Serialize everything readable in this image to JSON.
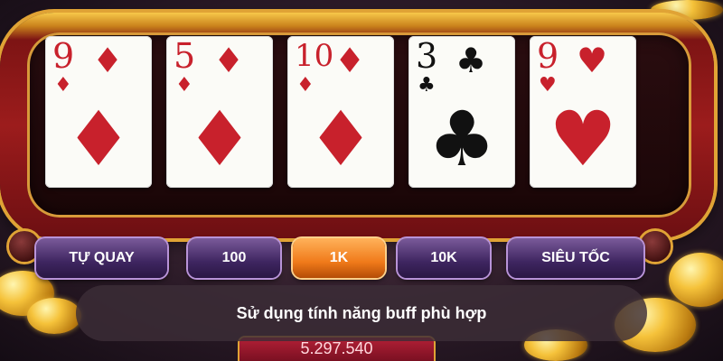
{
  "cards": [
    {
      "rank": "9",
      "suit": "♦",
      "color": "red"
    },
    {
      "rank": "5",
      "suit": "♦",
      "color": "red"
    },
    {
      "rank": "10",
      "suit": "♦",
      "color": "red"
    },
    {
      "rank": "3",
      "suit": "♣",
      "color": "black"
    },
    {
      "rank": "9",
      "suit": "♥",
      "color": "red"
    }
  ],
  "controls": {
    "auto_spin": "TỰ QUAY",
    "bet_100": "100",
    "bet_1k": "1K",
    "bet_10k": "10K",
    "turbo": "SIÊU TỐC",
    "active": "1K"
  },
  "caption": "Sử dụng tính năng buff phù hợp",
  "balance": "5.297.540",
  "colors": {
    "card_red": "#c8212c",
    "active_button": "#f07a1a",
    "button": "#3e2560",
    "frame": "#9c1c1c",
    "gold": "#e0a335"
  }
}
